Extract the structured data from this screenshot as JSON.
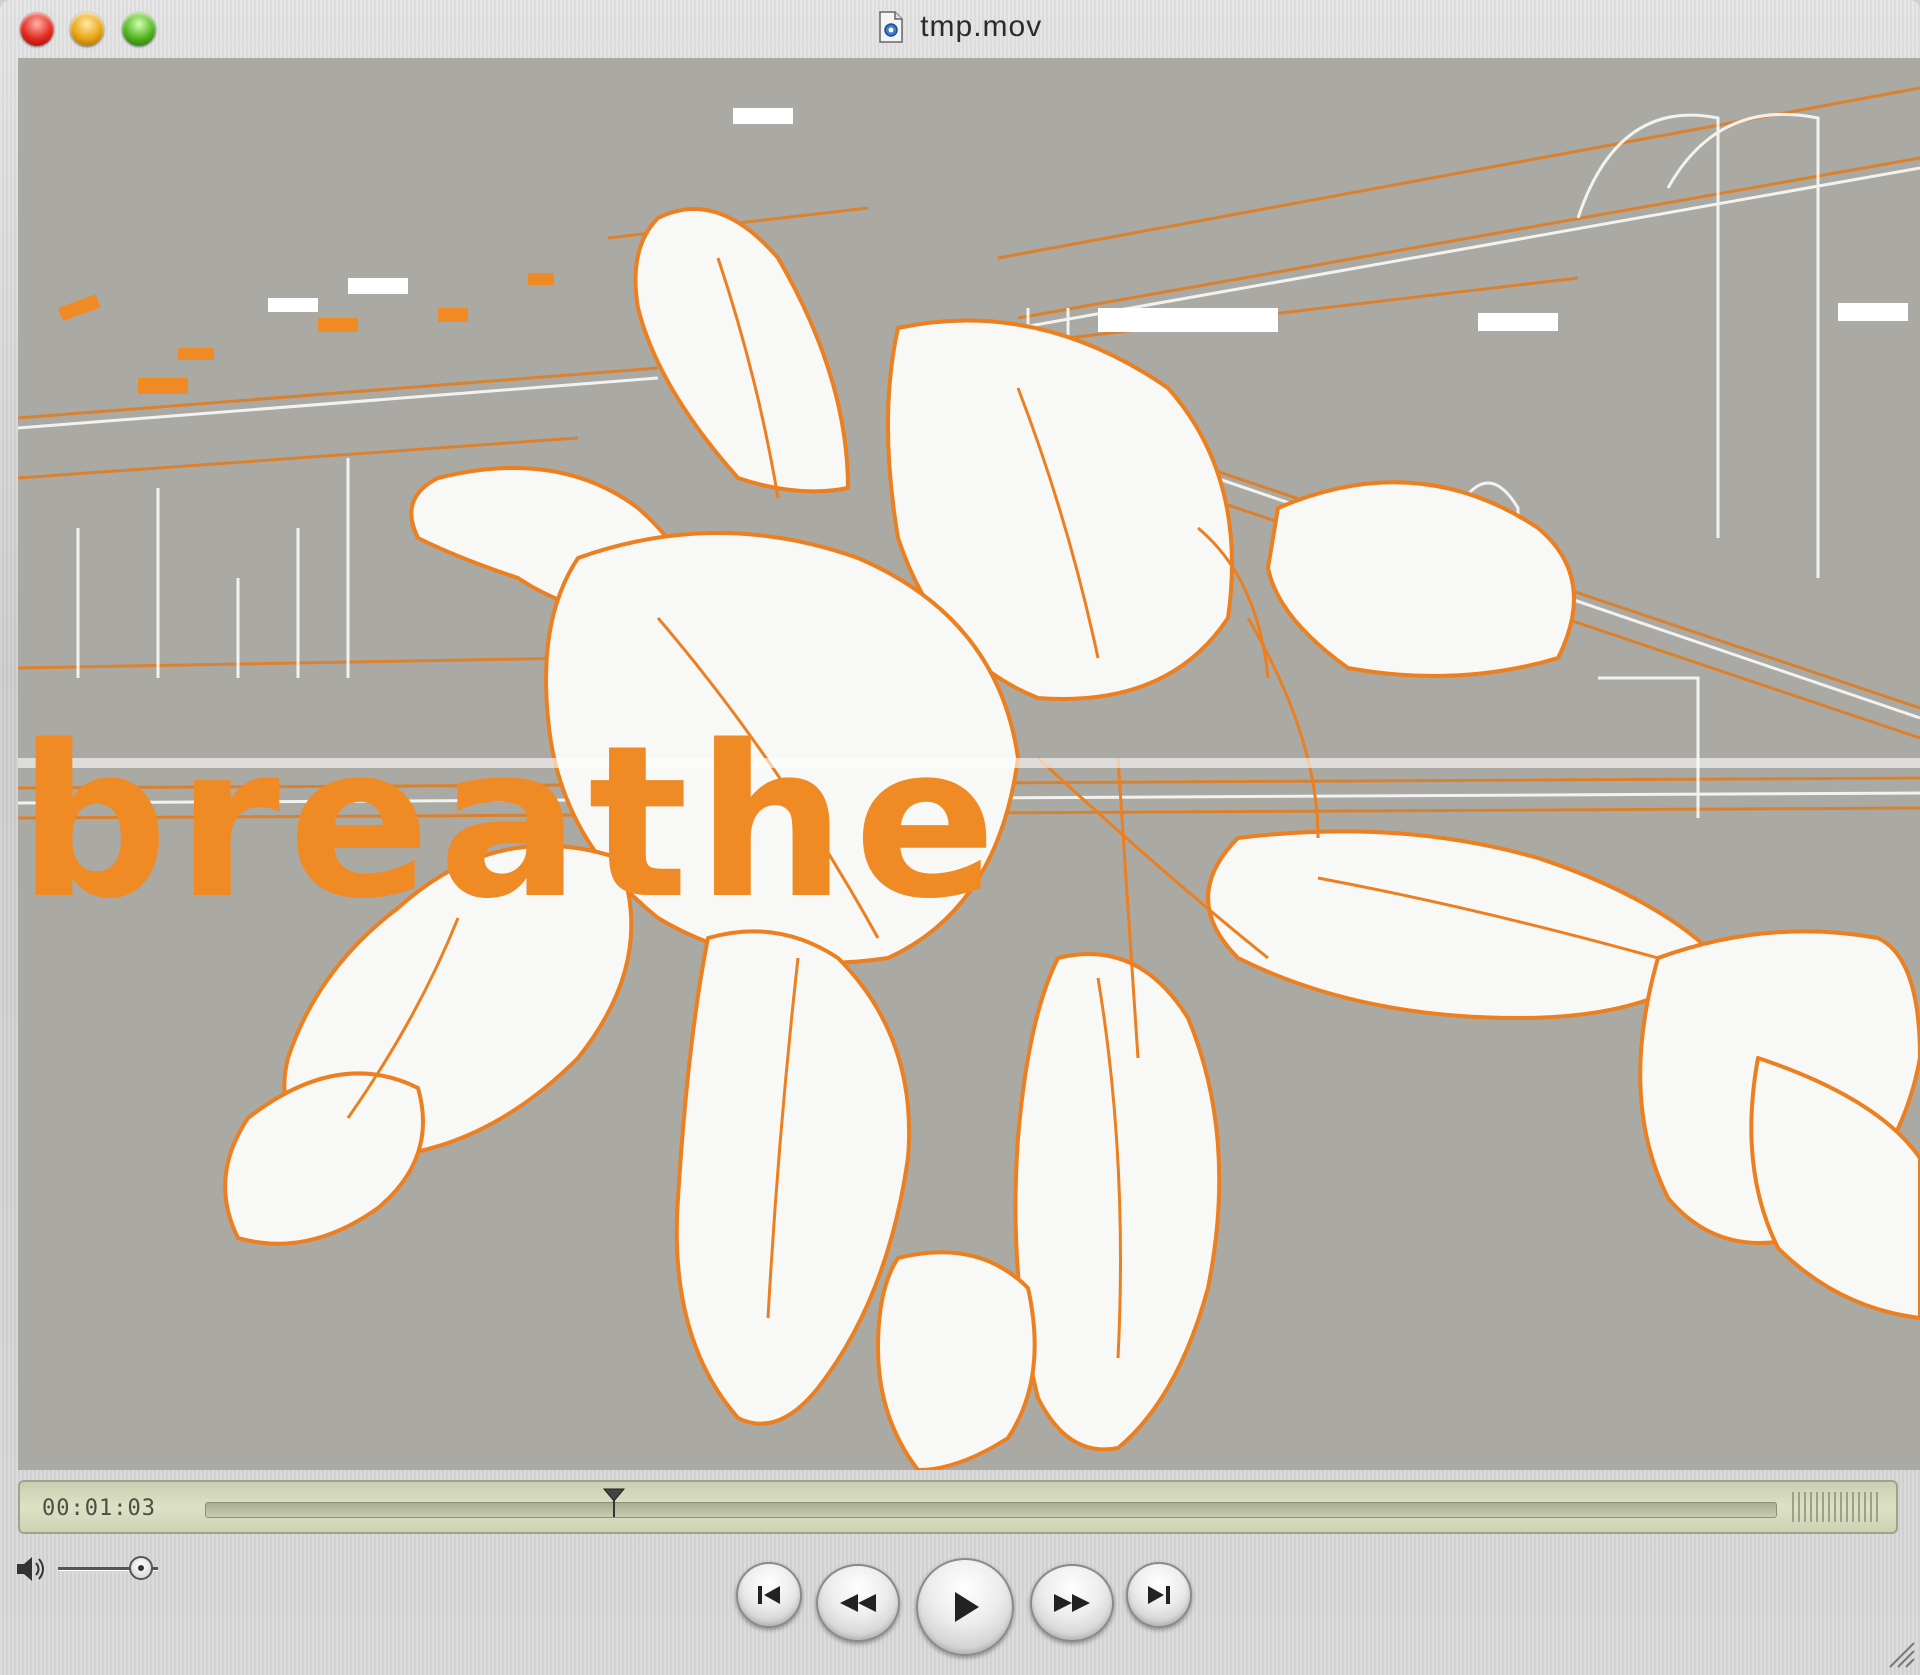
{
  "window": {
    "title": "tmp.mov",
    "title_icon": "quicktime-document-icon"
  },
  "video": {
    "overlay_text": "breathe",
    "colors": {
      "background": "#aaa9a3",
      "accent": "#f08a24",
      "line": "#ffffff"
    }
  },
  "timeline": {
    "current_time": "00:01:03",
    "progress": 0.26
  },
  "controls": {
    "volume_level": 0.83,
    "buttons": [
      "go-to-start-icon",
      "rewind-icon",
      "play-icon",
      "fast-forward-icon",
      "go-to-end-icon"
    ]
  }
}
